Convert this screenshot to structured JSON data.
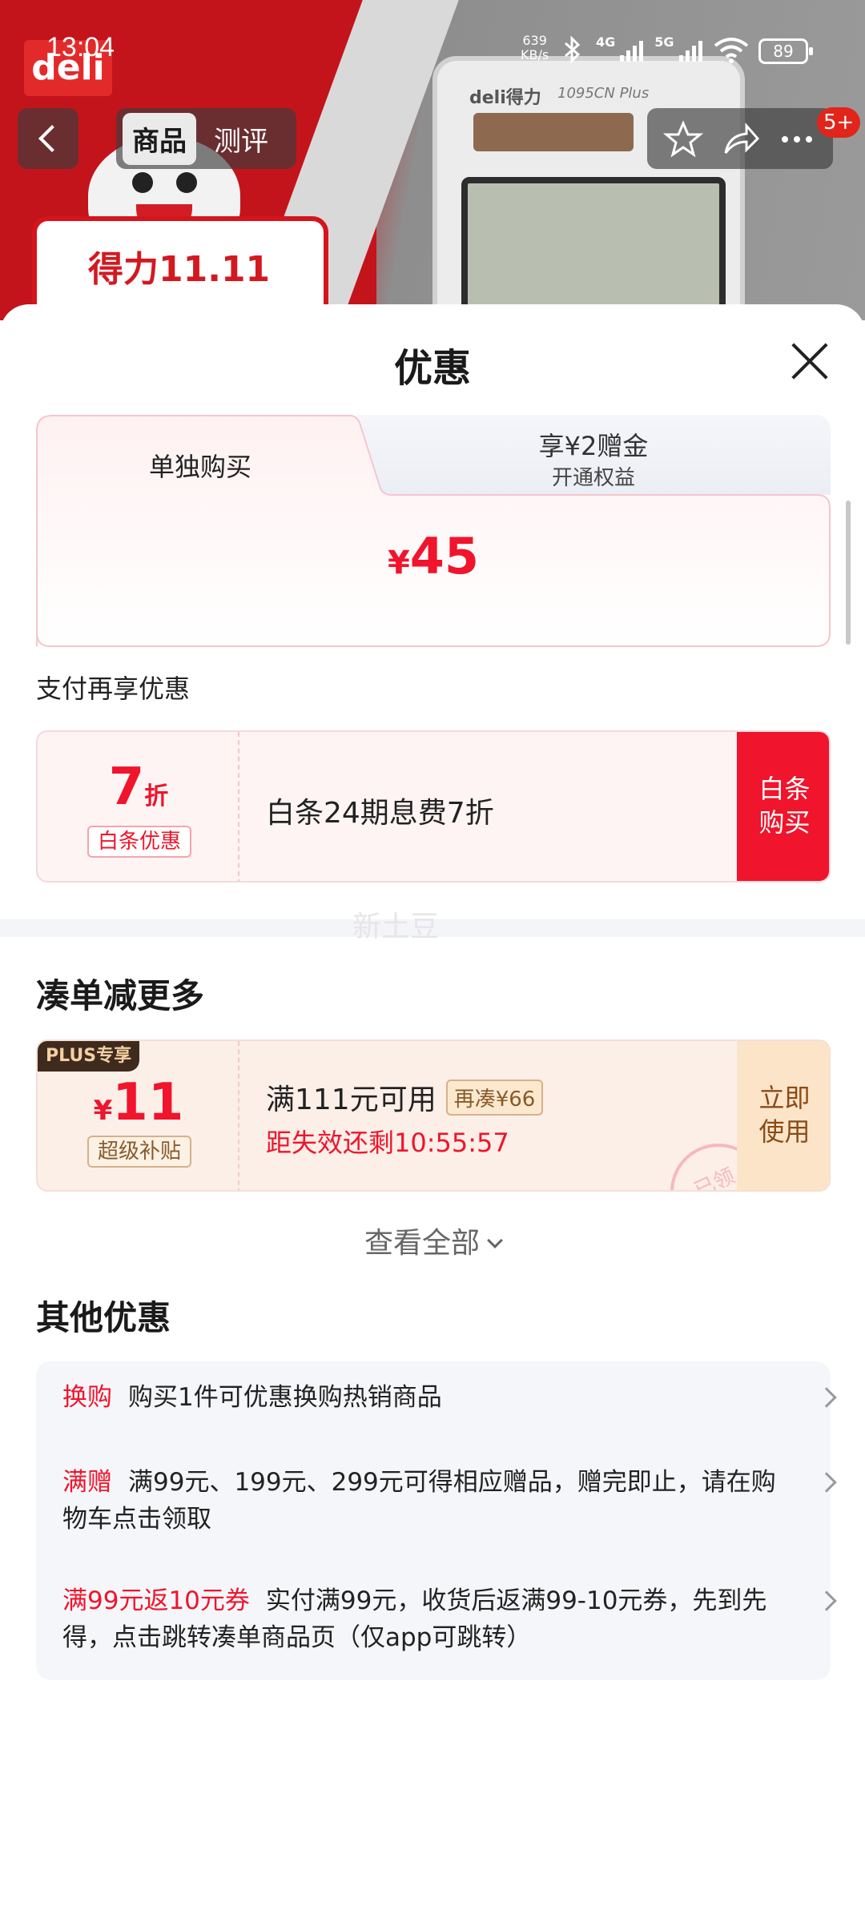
{
  "status_bar": {
    "time": "13:04",
    "net_speed_value": "639",
    "net_speed_unit": "KB/s",
    "network_4g": "4G",
    "network_5g": "5G",
    "battery": "89"
  },
  "background": {
    "brand_logo": "deli",
    "promo_text": "得力11.11",
    "calc_brand": "deli得力",
    "calc_model": "1095CN Plus"
  },
  "top_nav": {
    "tabs": [
      {
        "label": "商品",
        "active": true
      },
      {
        "label": "测评",
        "active": false
      }
    ],
    "notification_badge": "5+"
  },
  "sheet": {
    "title": "优惠",
    "price_tabs": {
      "left_label": "单独购买",
      "right_line1": "享¥2赠金",
      "right_line2": "开通权益"
    },
    "price_symbol": "¥",
    "price_value": "45",
    "pay_section_title": "支付再享优惠",
    "baitiao": {
      "discount_value": "7",
      "discount_unit": "折",
      "tag": "白条优惠",
      "description": "白条24期息费7折",
      "buy_line1": "白条",
      "buy_line2": "购买"
    },
    "watermark": "新土豆",
    "bundle_section_title": "凑单减更多",
    "coupon": {
      "plus_tag": "PLUS专享",
      "symbol": "¥",
      "amount": "11",
      "tag": "超级补贴",
      "condition": "满111元可用",
      "extra": "再凑¥66",
      "countdown": "距失效还剩10:55:57",
      "use_line1": "立即",
      "use_line2": "使用",
      "stamp": "已领"
    },
    "view_all": "查看全部",
    "other_section_title": "其他优惠",
    "other_offers": [
      {
        "tag": "换购",
        "text": "购买1件可优惠换购热销商品"
      },
      {
        "tag": "满赠",
        "text": "满99元、199元、299元可得相应赠品，赠完即止，请在购物车点击领取"
      },
      {
        "tag": "满99元返10元券",
        "text": "实付满99元，收货后返满99-10元券，先到先得，点击跳转凑单商品页（仅app可跳转）"
      }
    ]
  },
  "colors": {
    "accent_red": "#f0142c",
    "coupon_bg": "#fcefe8",
    "card_bg": "#f5f6f9"
  }
}
